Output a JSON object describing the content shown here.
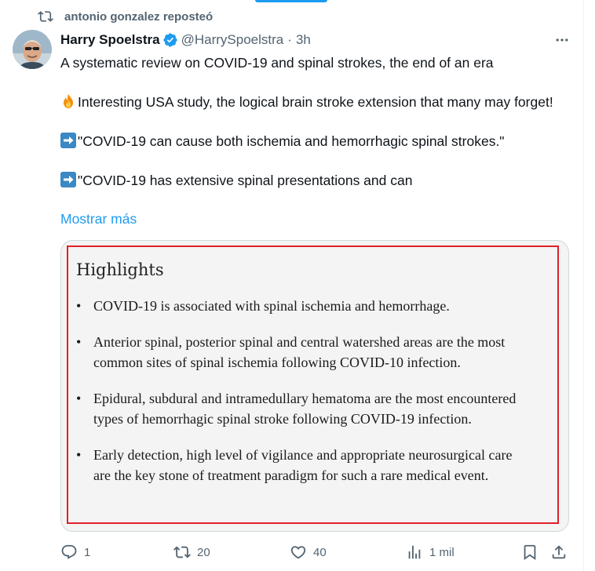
{
  "repost": {
    "text": "antonio gonzalez reposteó",
    "icon": "repost-icon"
  },
  "author": {
    "name": "Harry Spoelstra",
    "handle": "@HarrySpoelstra",
    "separator": "·",
    "time": "3h",
    "verified_icon": "verified-badge-icon",
    "verified_color": "#1d9bf0"
  },
  "tweet": {
    "line1": "A systematic review on COVID-19 and spinal strokes, the end of an era",
    "line2": "Interesting USA study, the logical brain stroke extension that many may forget!",
    "line3": "\"COVID-19 can cause both ischemia and hemorrhagic spinal strokes.\"",
    "line4": "\"COVID-19 has extensive spinal presentations and can",
    "show_more": "Mostrar más",
    "emojis": [
      "fire-emoji",
      "right-arrow-emoji",
      "right-arrow-emoji"
    ]
  },
  "media": {
    "title": "Highlights",
    "bullet": "•",
    "items": [
      "COVID-19 is associated with spinal ischemia and hemorrhage.",
      "Anterior spinal, posterior spinal and central watershed areas are the most common sites of spinal ischemia following COVID-10 infection.",
      "Epidural, subdural and intramedullary hematoma are the most encountered types of hemorrhagic spinal stroke following COVID-19 infection.",
      "Early detection, high level of vigilance and appropriate neurosurgical care are the key stone of treatment paradigm for such a rare medical event."
    ],
    "highlight_border_color": "#e0202a"
  },
  "actions": {
    "reply_count": "1",
    "repost_count": "20",
    "like_count": "40",
    "views_count": "1 mil"
  },
  "colors": {
    "accent": "#1d9bf0",
    "text_secondary": "#536471",
    "text_primary": "#0f1419"
  }
}
